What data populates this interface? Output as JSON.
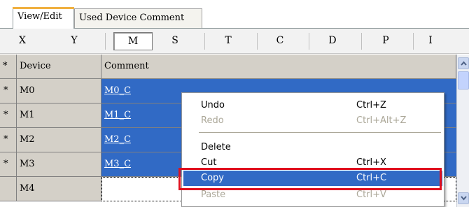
{
  "tabs": [
    {
      "label": "View/Edit",
      "active": true
    },
    {
      "label": "Used Device Comment",
      "active": false
    }
  ],
  "device_types": [
    "X",
    "Y",
    "M",
    "S",
    "T",
    "C",
    "D",
    "P",
    "I"
  ],
  "selected_device_type": "M",
  "grid": {
    "headers": {
      "star": "*",
      "device": "Device",
      "comment": "Comment"
    },
    "rows": [
      {
        "star": "*",
        "device": "M0",
        "comment": "M0_C",
        "selected": true
      },
      {
        "star": "*",
        "device": "M1",
        "comment": "M1_C",
        "selected": true
      },
      {
        "star": "*",
        "device": "M2",
        "comment": "M2_C",
        "selected": true
      },
      {
        "star": "*",
        "device": "M3",
        "comment": "M3_C",
        "selected": true
      },
      {
        "star": "",
        "device": "M4",
        "comment": "",
        "selected": false
      }
    ]
  },
  "context_menu": {
    "items": [
      {
        "label": "Undo",
        "shortcut": "Ctrl+Z",
        "enabled": true
      },
      {
        "label": "Redo",
        "shortcut": "Ctrl+Alt+Z",
        "enabled": false
      },
      {
        "label": "Delete",
        "shortcut": "",
        "enabled": true
      },
      {
        "label": "Cut",
        "shortcut": "Ctrl+X",
        "enabled": true
      },
      {
        "label": "Copy",
        "shortcut": "Ctrl+C",
        "enabled": true,
        "highlighted": true
      },
      {
        "label": "Paste",
        "shortcut": "Ctrl+V",
        "enabled": false
      }
    ]
  },
  "colors": {
    "selection": "#316ac5",
    "highlight_box": "#e0101e",
    "header_gray": "#d4d0c8"
  }
}
